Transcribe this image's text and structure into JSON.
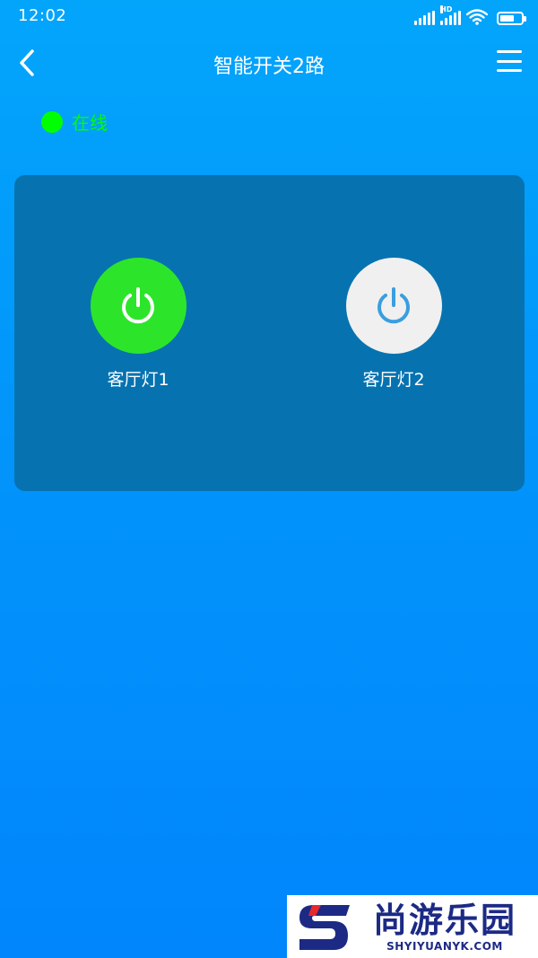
{
  "status_bar": {
    "time": "12:02",
    "hd_label": "HD",
    "battery_level": 0.7
  },
  "header": {
    "title": "智能开关2路",
    "back_icon": "chevron-left-icon",
    "menu_icon": "hamburger-menu-icon"
  },
  "device_status": {
    "label": "在线",
    "color": "#00ff00"
  },
  "switches": [
    {
      "label": "客厅灯1",
      "state": "on",
      "color": "#2ce52b"
    },
    {
      "label": "客厅灯2",
      "state": "off",
      "color": "#f0f0f0"
    }
  ],
  "colors": {
    "background_top": "#03a5fb",
    "background_bottom": "#0186fc",
    "panel": "#0673b0",
    "icon_off": "#3a9ee0"
  },
  "watermark": {
    "name": "尚游乐园",
    "site": "SHYIYUANYK.COM"
  }
}
